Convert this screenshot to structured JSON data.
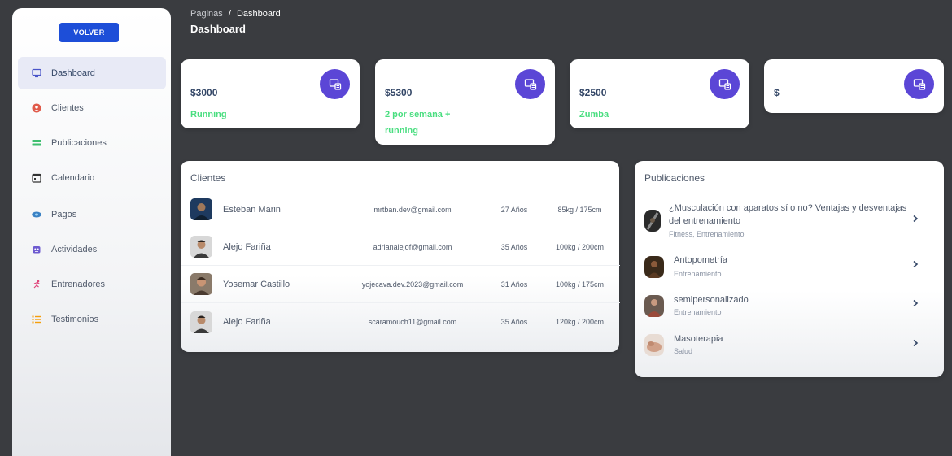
{
  "sidebar": {
    "back_button": "VOLVER",
    "items": [
      {
        "label": "Dashboard",
        "icon": "monitor-icon",
        "active": true
      },
      {
        "label": "Clientes",
        "icon": "user-circle-icon",
        "active": false
      },
      {
        "label": "Publicaciones",
        "icon": "list-icon",
        "active": false
      },
      {
        "label": "Calendario",
        "icon": "calendar-icon",
        "active": false
      },
      {
        "label": "Pagos",
        "icon": "money-icon",
        "active": false
      },
      {
        "label": "Actividades",
        "icon": "robot-icon",
        "active": false
      },
      {
        "label": "Entrenadores",
        "icon": "runner-icon",
        "active": false
      },
      {
        "label": "Testimonios",
        "icon": "list-ordered-icon",
        "active": false
      }
    ]
  },
  "header": {
    "breadcrumb_root": "Paginas",
    "breadcrumb_sep": "/",
    "breadcrumb_current": "Dashboard",
    "title": "Dashboard"
  },
  "stats": [
    {
      "amount": "$3000",
      "label": "Running"
    },
    {
      "amount": "$5300",
      "label": "2 por semana + running"
    },
    {
      "amount": "$2500",
      "label": "Zumba"
    },
    {
      "amount": "$",
      "label": ""
    }
  ],
  "clients": {
    "title": "Clientes",
    "rows": [
      {
        "name": "Esteban Marin",
        "email": "mrtban.dev@gmail.com",
        "age": "27 Años",
        "measure": "85kg / 175cm"
      },
      {
        "name": "Alejo Fariña",
        "email": "adrianalejof@gmail.com",
        "age": "35 Años",
        "measure": "100kg / 200cm"
      },
      {
        "name": "Yosemar Castillo",
        "email": "yojecava.dev.2023@gmail.com",
        "age": "31 Años",
        "measure": "100kg / 175cm"
      },
      {
        "name": "Alejo Fariña",
        "email": "scaramouch11@gmail.com",
        "age": "35 Años",
        "measure": "120kg / 200cm"
      }
    ]
  },
  "publications": {
    "title": "Publicaciones",
    "items": [
      {
        "title": "¿Musculación con aparatos sí o no? Ventajas y desventajas del entrenamiento",
        "tag": "Fitness, Entrenamiento"
      },
      {
        "title": "Antopometría",
        "tag": "Entrenamiento"
      },
      {
        "title": "semipersonalizado",
        "tag": "Entrenamiento"
      },
      {
        "title": "Masoterapia",
        "tag": "Salud"
      }
    ]
  },
  "colors": {
    "accent": "#5b46d6",
    "button": "#1d4ed8",
    "success": "#4ade80",
    "background": "#3a3c40"
  }
}
